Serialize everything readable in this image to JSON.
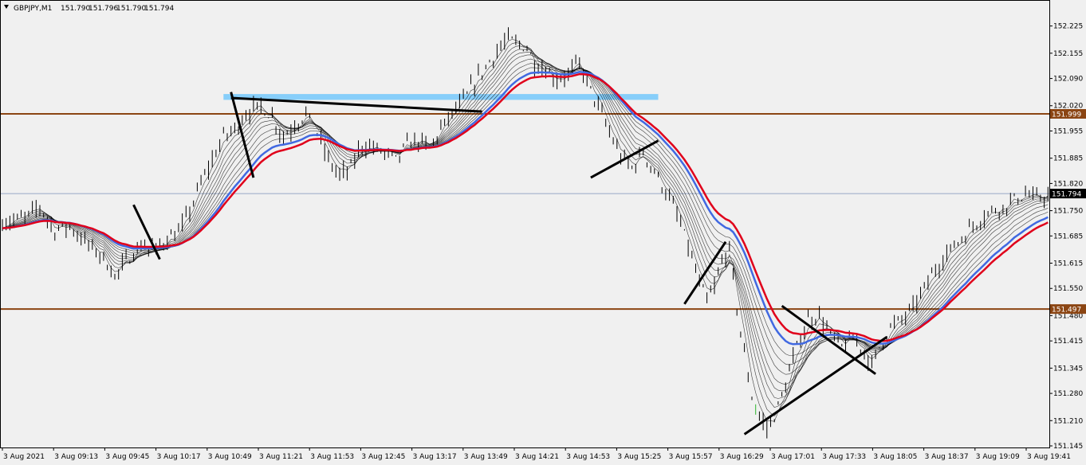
{
  "header": {
    "symbol_label": "GBPJPY,M1",
    "ohlc": [
      "151.790",
      "151.796",
      "151.790",
      "151.794"
    ]
  },
  "colors": {
    "background": "#f0f0f0",
    "bars": "#000000",
    "ema_fast": "#000000",
    "ema_blue": "#4169e1",
    "ema_red": "#e0001b",
    "level_line": "#8b4513",
    "zone": "#87cefa",
    "trendline": "#000000",
    "current_line": "#7a8fb8",
    "current_tag": "#000000"
  },
  "chart_data": {
    "type": "candlestick",
    "symbol": "GBPJPY",
    "timeframe": "M1",
    "ylim": [
      151.145,
      152.255
    ],
    "y_ticks": [
      "152.225",
      "152.155",
      "152.090",
      "152.020",
      "151.955",
      "151.885",
      "151.820",
      "151.750",
      "151.685",
      "151.615",
      "151.550",
      "151.480",
      "151.415",
      "151.345",
      "151.280",
      "151.210",
      "151.145"
    ],
    "x_ticks": [
      "3 Aug 2021",
      "3 Aug 09:13",
      "3 Aug 09:45",
      "3 Aug 10:17",
      "3 Aug 10:49",
      "3 Aug 11:21",
      "3 Aug 11:53",
      "3 Aug 12:45",
      "3 Aug 13:17",
      "3 Aug 13:49",
      "3 Aug 14:21",
      "3 Aug 14:53",
      "3 Aug 15:25",
      "3 Aug 15:57",
      "3 Aug 16:29",
      "3 Aug 17:01",
      "3 Aug 17:33",
      "3 Aug 18:05",
      "3 Aug 18:37",
      "3 Aug 19:09",
      "3 Aug 19:41"
    ],
    "price_path": [
      [
        0,
        151.72
      ],
      [
        6,
        151.73
      ],
      [
        10,
        151.76
      ],
      [
        14,
        151.7
      ],
      [
        18,
        151.71
      ],
      [
        22,
        151.67
      ],
      [
        27,
        151.63
      ],
      [
        30,
        151.58
      ],
      [
        33,
        151.62
      ],
      [
        37,
        151.66
      ],
      [
        41,
        151.65
      ],
      [
        44,
        151.68
      ],
      [
        47,
        151.69
      ],
      [
        50,
        151.75
      ],
      [
        53,
        151.82
      ],
      [
        56,
        151.88
      ],
      [
        59,
        151.94
      ],
      [
        62,
        151.96
      ],
      [
        65,
        152.0
      ],
      [
        69,
        152.02
      ],
      [
        72,
        151.99
      ],
      [
        75,
        151.94
      ],
      [
        78,
        151.97
      ],
      [
        81,
        152.0
      ],
      [
        84,
        151.95
      ],
      [
        87,
        151.88
      ],
      [
        90,
        151.84
      ],
      [
        93,
        151.86
      ],
      [
        96,
        151.92
      ],
      [
        99,
        151.91
      ],
      [
        102,
        151.9
      ],
      [
        105,
        151.88
      ],
      [
        108,
        151.92
      ],
      [
        111,
        151.93
      ],
      [
        114,
        151.91
      ],
      [
        117,
        151.96
      ],
      [
        120,
        152.0
      ],
      [
        123,
        152.03
      ],
      [
        126,
        152.08
      ],
      [
        129,
        152.12
      ],
      [
        132,
        152.16
      ],
      [
        135,
        152.19
      ],
      [
        137,
        152.18
      ],
      [
        140,
        152.17
      ],
      [
        142,
        152.13
      ],
      [
        145,
        152.11
      ],
      [
        148,
        152.09
      ],
      [
        151,
        152.1
      ],
      [
        154,
        152.13
      ],
      [
        156,
        152.08
      ],
      [
        159,
        152.02
      ],
      [
        162,
        151.95
      ],
      [
        165,
        151.89
      ],
      [
        168,
        151.86
      ],
      [
        171,
        151.9
      ],
      [
        174,
        151.85
      ],
      [
        177,
        151.8
      ],
      [
        180,
        151.74
      ],
      [
        183,
        151.66
      ],
      [
        186,
        151.56
      ],
      [
        188,
        151.52
      ],
      [
        190,
        151.55
      ],
      [
        192,
        151.62
      ],
      [
        194,
        151.65
      ],
      [
        196,
        151.5
      ],
      [
        198,
        151.38
      ],
      [
        200,
        151.27
      ],
      [
        202,
        151.22
      ],
      [
        204,
        151.19
      ],
      [
        206,
        151.22
      ],
      [
        209,
        151.3
      ],
      [
        212,
        151.4
      ],
      [
        215,
        151.47
      ],
      [
        218,
        151.48
      ],
      [
        221,
        151.43
      ],
      [
        224,
        151.4
      ],
      [
        227,
        151.42
      ],
      [
        230,
        151.39
      ],
      [
        232,
        151.35
      ],
      [
        234,
        151.4
      ],
      [
        237,
        151.45
      ],
      [
        240,
        151.47
      ],
      [
        243,
        151.5
      ],
      [
        246,
        151.55
      ],
      [
        249,
        151.6
      ],
      [
        252,
        151.64
      ],
      [
        255,
        151.67
      ],
      [
        258,
        151.7
      ],
      [
        261,
        151.73
      ],
      [
        264,
        151.75
      ],
      [
        267,
        151.76
      ],
      [
        270,
        151.78
      ],
      [
        273,
        151.79
      ],
      [
        276,
        151.78
      ],
      [
        279,
        151.79
      ]
    ],
    "ema_periods": [
      3,
      5,
      7,
      9,
      11,
      13,
      16,
      19,
      22
    ],
    "ema_blue_period": 26,
    "ema_red_period": 30,
    "levels": [
      {
        "price": 151.999,
        "label": "151.999"
      },
      {
        "price": 151.497,
        "label": "151.497"
      }
    ],
    "current": {
      "price": 151.794,
      "label": "151.794"
    },
    "zone": {
      "price_low": 152.035,
      "price_high": 152.05,
      "start_minute": 59,
      "end_minute": 175
    },
    "trendlines": [
      [
        [
          35,
          151.765
        ],
        [
          42,
          151.625
        ]
      ],
      [
        [
          61,
          152.055
        ],
        [
          67,
          151.835
        ]
      ],
      [
        [
          61,
          152.04
        ],
        [
          128,
          152.005
        ]
      ],
      [
        [
          157,
          151.835
        ],
        [
          175,
          151.93
        ]
      ],
      [
        [
          182,
          151.51
        ],
        [
          193,
          151.67
        ]
      ],
      [
        [
          198,
          151.175
        ],
        [
          236,
          151.425
        ]
      ],
      [
        [
          208,
          151.505
        ],
        [
          233,
          151.33
        ]
      ]
    ]
  }
}
